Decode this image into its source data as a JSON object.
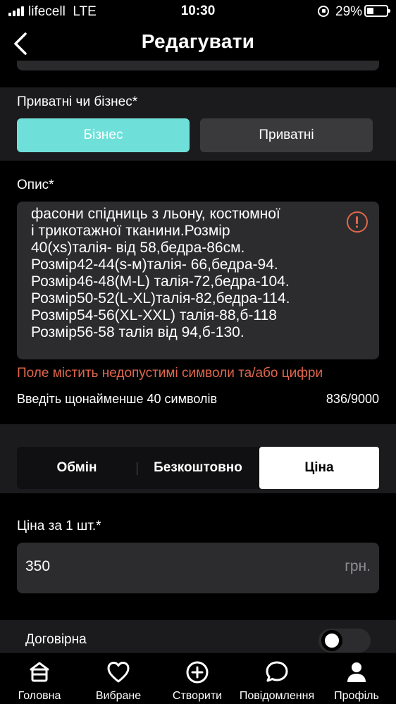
{
  "status_bar": {
    "carrier": "lifecell",
    "network": "LTE",
    "time": "10:30",
    "battery": "29%"
  },
  "header": {
    "title": "Редагувати",
    "back_icon": "chevron-left-icon"
  },
  "seller_type": {
    "label": "Приватні чи бізнес*",
    "options": [
      "Бізнес",
      "Приватні"
    ],
    "selected": "Бізнес",
    "selected_color": "#6fe0d9"
  },
  "description": {
    "label": "Опис*",
    "lines": [
      "фасони спідниць з льону, костюмної",
      "і трикотажної тканини.Розмір",
      "40(xs)талія- від 58,бедра-86см.",
      "Розмір42-44(s-м)талія- 66,бедра-94.",
      "Розмір46-48(M-L) талія-72,бедра-104.",
      "Розмір50-52(L-XL)талія-82,бедра-114.",
      "Розмір54-56(XL-XXL) талія-88,б-118",
      "Розмір56-58 талія від 94,б-130."
    ],
    "error": "Поле містить недопустимі символи та/або цифри",
    "hint": "Введіть щонайменше 40 символів",
    "counter": "836/9000",
    "error_color": "#e0674b"
  },
  "price_type": {
    "tabs": [
      "Обмін",
      "Безкоштовно",
      "Ціна"
    ],
    "selected": "Ціна"
  },
  "price": {
    "label": "Ціна за 1 шт.*",
    "value": "350",
    "unit": "грн."
  },
  "negotiable": {
    "label": "Договірна",
    "enabled": false
  },
  "bottom_nav": [
    {
      "label": "Головна",
      "icon": "home-icon"
    },
    {
      "label": "Вибране",
      "icon": "heart-icon"
    },
    {
      "label": "Створити",
      "icon": "plus-circle-icon"
    },
    {
      "label": "Повідомлення",
      "icon": "chat-bubble-icon"
    },
    {
      "label": "Профіль",
      "icon": "user-icon"
    }
  ]
}
